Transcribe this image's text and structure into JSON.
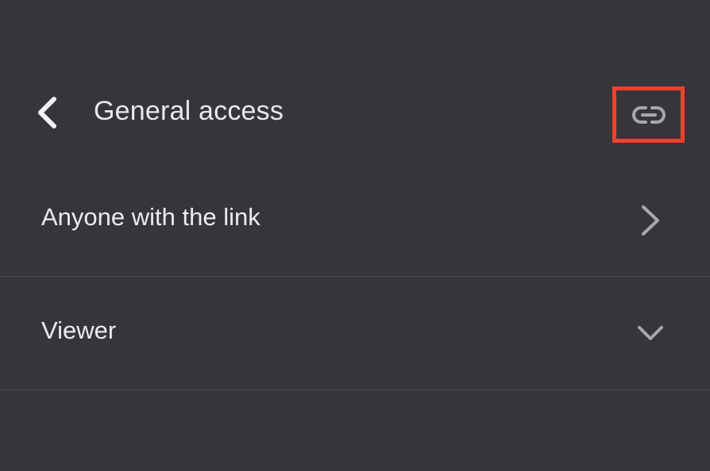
{
  "header": {
    "title": "General access",
    "back_icon": "chevron-left-icon",
    "link_icon": "link-icon"
  },
  "access": {
    "label": "Anyone with the link",
    "icon": "chevron-right-icon"
  },
  "role": {
    "selected": "Viewer",
    "icon": "chevron-down-icon"
  },
  "colors": {
    "background": "#36353a",
    "text": "#ebeaee",
    "icon": "#a8a7ac",
    "highlight": "#f0402b",
    "divider": "#4a494e"
  }
}
